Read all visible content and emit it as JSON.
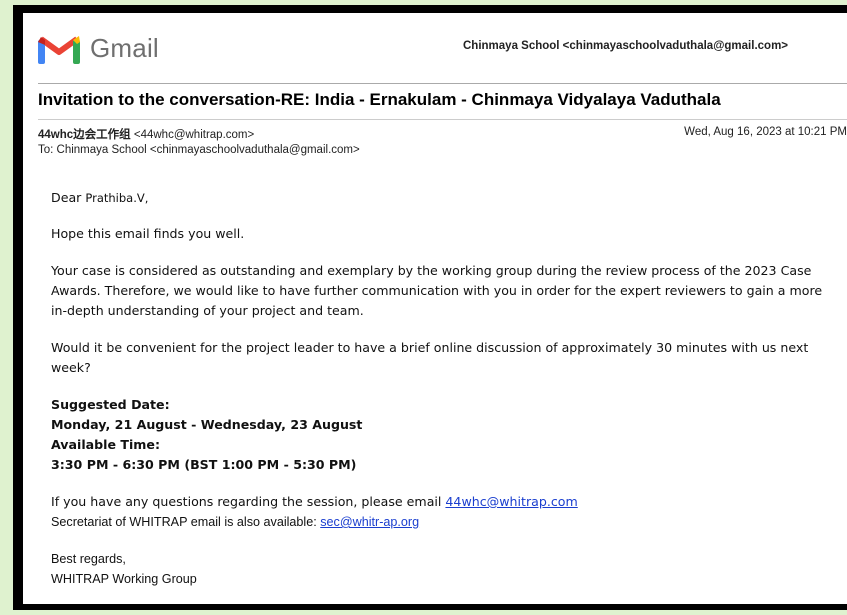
{
  "app": {
    "name": "Gmail",
    "account": "Chinmaya School <chinmayaschoolvaduthala@gmail.com>"
  },
  "email": {
    "subject": "Invitation to the conversation-RE: India - Ernakulam - Chinmaya Vidyalaya Vaduthala",
    "from_name": "44whc边会工作组",
    "from_addr": " <44whc@whitrap.com>",
    "to_line": "To: Chinmaya School <chinmayaschoolvaduthala@gmail.com>",
    "date": "Wed, Aug 16, 2023 at 10:21 PM",
    "greeting_prefix": "Dear ",
    "greeting_name": "Prathiba.V,",
    "line_hope": "Hope this email finds you well.",
    "para_case": "Your case is considered as outstanding and exemplary by the working group during the review process of the 2023 Case Awards. Therefore, we would like to have further communication with you in order for the expert reviewers to gain a more in-depth understanding of your project and team.",
    "para_convenient": "Would it be convenient for the project leader to have a brief online discussion of approximately 30 minutes with us next week?",
    "suggested_date_label": "Suggested Date:",
    "suggested_date_value": "Monday, 21 August - Wednesday, 23 August",
    "available_time_label": "Available Time:",
    "available_time_value": "3:30 PM - 6:30 PM (BST 1:00 PM - 5:30 PM)",
    "questions_text": "If you have any questions regarding the session, please email ",
    "questions_link": "44whc@whitrap.com ",
    "secretariat_text": "Secretariat of WHITRAP email is also available: ",
    "secretariat_link": "sec@whitr-ap.org",
    "regards": "Best regards,",
    "signature": "WHITRAP Working Group"
  },
  "colors": {
    "background": "#dff2cf",
    "link": "#1a3ecf"
  },
  "icons": {
    "logo": "gmail-logo-icon"
  }
}
